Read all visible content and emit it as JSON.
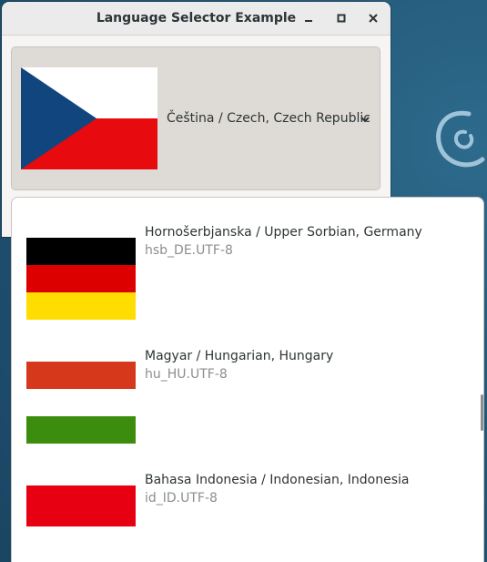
{
  "window": {
    "title": "Language Selector Example"
  },
  "selector": {
    "label": "Čeština / Czech, Czech Republic",
    "flag": "czech-flag"
  },
  "languages": [
    {
      "name": "Hornošerbjanska / Upper Sorbian, Germany",
      "code": "hsb_DE.UTF-8",
      "flag": "german-flag"
    },
    {
      "name": "Magyar / Hungarian, Hungary",
      "code": "hu_HU.UTF-8",
      "flag": "hungarian-flag"
    },
    {
      "name": "Bahasa Indonesia / Indonesian, Indonesia",
      "code": "id_ID.UTF-8",
      "flag": "indonesian-flag"
    }
  ],
  "colors": {
    "desktop": "#245a7a",
    "czech_blue": "#11457e",
    "czech_red": "#e70a0f",
    "german_black": "#000000",
    "german_red": "#dd0000",
    "german_gold": "#ffdd00",
    "hungary_red": "#d6381c",
    "hungary_green": "#3c8d0d",
    "indonesia_red": "#e70011"
  }
}
